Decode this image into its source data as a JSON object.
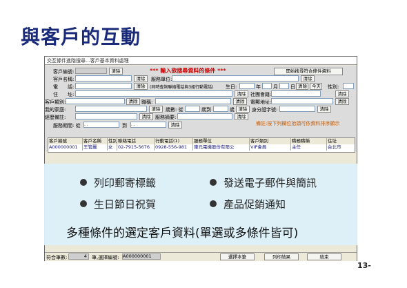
{
  "slide": {
    "title": "與客戶的互動",
    "page_number": "13-"
  },
  "window": {
    "title": "交互條件進階搜尋...客戶基本資料處理"
  },
  "form": {
    "labels": {
      "cust_id": "客戶編號:",
      "cust_name": "客戶名稱:",
      "phone": "電　　話:",
      "address": "住　　址:",
      "cust_type": "客戶類別:",
      "home": "我的家庭:",
      "pay_status": "經歷備註:",
      "date_range": "服務期間: 從",
      "company": "服務單位:",
      "title": "職稱:",
      "birthday": "生日:",
      "year": "年",
      "month": "月",
      "day": "日",
      "gender": "性別:",
      "social": "社團會籍:",
      "email": "電郵地址:",
      "age_from": "歲數: 從",
      "age_to": "歲到",
      "age_unit": "歲",
      "id_field": "身分證字號:",
      "summary_field": "服務摘要:",
      "to": "到"
    },
    "buttons": {
      "clear": "清除",
      "today": "今天",
      "search": "開始搜尋符合條件資料"
    },
    "phone_hint": "(同時查詢聯絡電話與3組行動電話)",
    "red_hint": "*** 輸入欲搜尋資料的條件 ***",
    "orange_hint": "備註:按下列欄位抬頭可依資料排序顯示",
    "date_from_value": "  .   .  ",
    "date_to_value": "  .   .  "
  },
  "grid": {
    "headers": [
      "客戶編號",
      "客戶名稱",
      "性別",
      "聯絡電話",
      "行動電話(1)",
      "服務單位",
      "客戶類別",
      "職務職稱",
      "住址"
    ],
    "rows": [
      [
        "A000000001",
        "王管麗",
        "女",
        "02-7915-5676",
        "0928-556-981",
        "東元電機股份有限公",
        "VIP會員",
        "主任",
        "台北市"
      ]
    ]
  },
  "overlay": {
    "bullets": [
      "列印郵寄標籤",
      "發送電子郵件與簡訊",
      "生日節日祝賀",
      "產品促銷通知"
    ],
    "summary": "多種條件的選定客戶資料(單選或多條件皆可)"
  },
  "status": {
    "count_label": "符合筆數:",
    "count_value": "4",
    "selected_label": "筆,選擇編號:",
    "selected_value": "A000000001",
    "buttons": [
      "選擇本筆",
      "列印結果",
      "結束"
    ]
  }
}
